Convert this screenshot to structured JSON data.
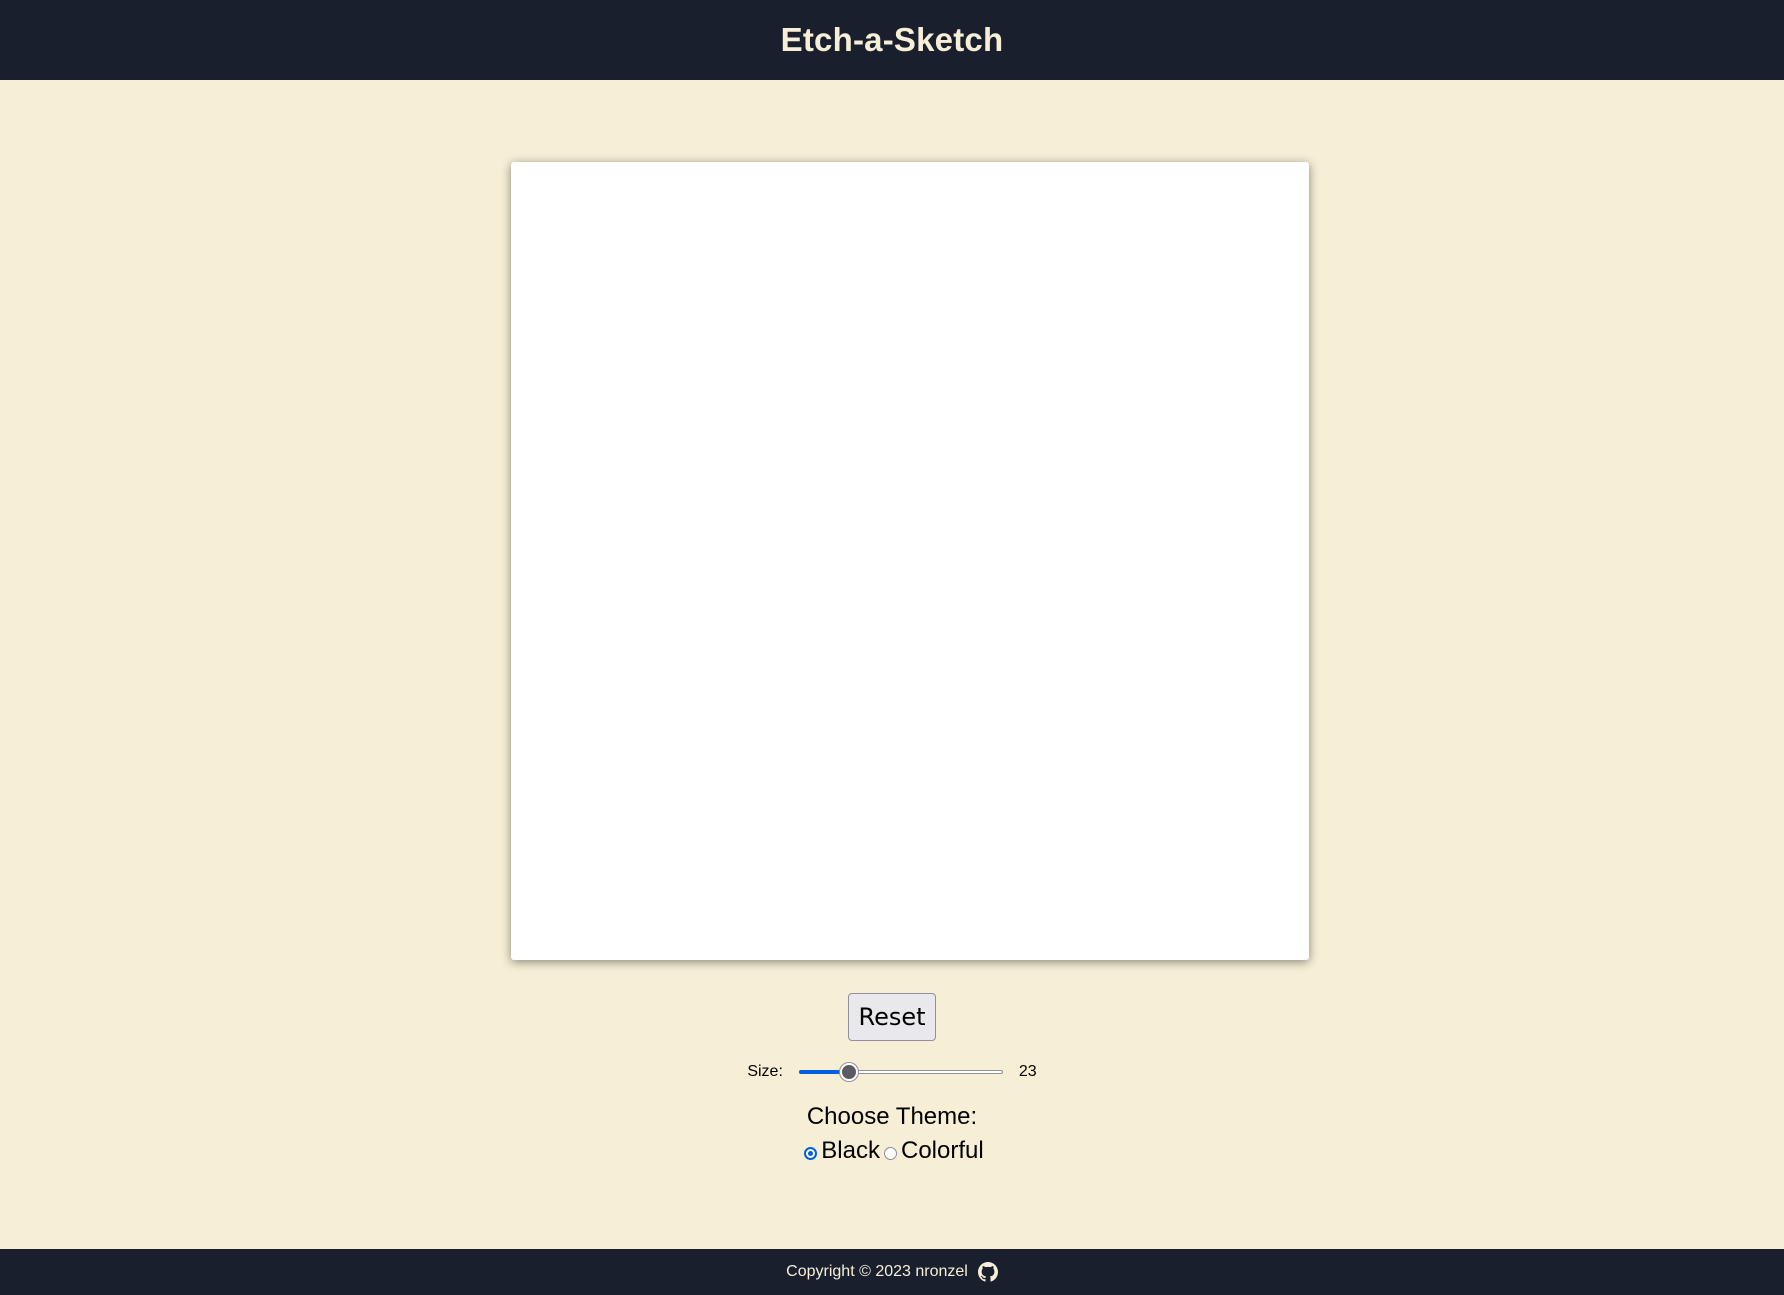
{
  "header": {
    "title": "Etch-a-Sketch"
  },
  "controls": {
    "reset_label": "Reset",
    "size_label": "Size:",
    "size_value": "23",
    "size_min": 1,
    "size_max": 100,
    "theme_title": "Choose Theme:",
    "theme_options": [
      {
        "label": "Black",
        "checked": true
      },
      {
        "label": "Colorful",
        "checked": false
      }
    ]
  },
  "footer": {
    "copyright": "Copyright © 2023 nronzel",
    "icon": "github-icon"
  },
  "colors": {
    "background": "#f6efd6",
    "bar": "#1a1f2e",
    "accent": "#0060df"
  }
}
